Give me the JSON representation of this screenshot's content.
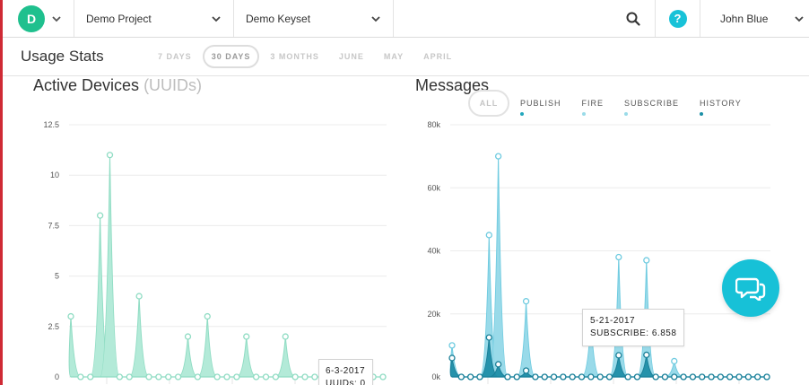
{
  "topbar": {
    "avatar_letter": "D",
    "project": "Demo Project",
    "keyset": "Demo Keyset",
    "help": "?",
    "user": "John Blue"
  },
  "subbar": {
    "title": "Usage Stats",
    "ranges": [
      "7 DAYS",
      "30 DAYS",
      "3 MONTHS",
      "JUNE",
      "MAY",
      "APRIL"
    ],
    "active_range": "30 DAYS"
  },
  "devices_panel": {
    "title": "Active Devices",
    "title_suffix": "(UUIDs)",
    "tooltip_date": "6-3-2017",
    "tooltip_value": "UUIDs: 0"
  },
  "messages_panel": {
    "title": "Messages",
    "legend": [
      {
        "label": "ALL"
      },
      {
        "label": "PUBLISH",
        "color": "#23a7bd"
      },
      {
        "label": "FIRE",
        "color": "#9adbe9"
      },
      {
        "label": "SUBSCRIBE",
        "color": "#9adbe9"
      },
      {
        "label": "HISTORY",
        "color": "#1b8fa6"
      }
    ],
    "tooltip_date": "5-21-2017",
    "tooltip_value": "SUBSCRIBE: 6.858"
  },
  "colors": {
    "devices_fill": "#b3ead8",
    "devices_line": "#8fdcc3",
    "subscribe_fill": "#94d8e8",
    "publish_fill": "#1f8ea8",
    "accent": "#17c1d7",
    "brand_green": "#1fc08e"
  },
  "chart_data": [
    {
      "type": "area",
      "title": "Active Devices (UUIDs)",
      "xlabel": "",
      "ylabel": "",
      "ylim": [
        0,
        12.5
      ],
      "yticks": [
        "0",
        "2.5",
        "5",
        "7.5",
        "10",
        "12.5"
      ],
      "series": [
        {
          "values": [
            3,
            0,
            0,
            8,
            11,
            0,
            0,
            4,
            0,
            0,
            0,
            0,
            2,
            0,
            3,
            0,
            0,
            0,
            2,
            0,
            0,
            0,
            2,
            0,
            0,
            0,
            0,
            0,
            0,
            0,
            0,
            0,
            0
          ]
        }
      ]
    },
    {
      "type": "area",
      "title": "Messages",
      "xlabel": "",
      "ylabel": "",
      "ylim": [
        0,
        80000
      ],
      "yticks": [
        "0k",
        "20k",
        "40k",
        "60k",
        "80k"
      ],
      "series": [
        {
          "name": "SUBSCRIBE",
          "values": [
            10000,
            0,
            0,
            0,
            45000,
            70000,
            0,
            0,
            24000,
            0,
            0,
            0,
            0,
            0,
            0,
            18000,
            0,
            0,
            38000,
            0,
            0,
            37000,
            0,
            0,
            5000,
            0,
            0,
            0,
            0,
            0,
            0,
            0,
            0,
            0,
            0
          ]
        },
        {
          "name": "PUBLISH",
          "values": [
            6000,
            0,
            0,
            0,
            12500,
            4000,
            0,
            0,
            2000,
            0,
            0,
            0,
            0,
            0,
            0,
            0,
            0,
            0,
            6858,
            0,
            0,
            7000,
            0,
            0,
            0,
            0,
            0,
            0,
            0,
            0,
            0,
            0,
            0,
            0,
            0
          ]
        }
      ]
    }
  ]
}
